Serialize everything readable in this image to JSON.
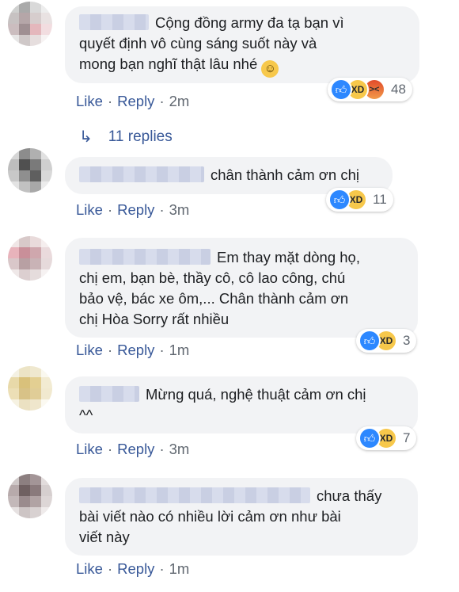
{
  "comments": [
    {
      "text_lines": [
        "Cộng đồng army đa tạ bạn vì",
        "quyết định vô cùng sáng suốt này và",
        "mong bạn nghĩ thật lâu nhé"
      ],
      "emoji": "☺",
      "actions": {
        "like": "Like",
        "reply": "Reply",
        "time": "2m"
      },
      "reaction_count": "48",
      "avatar_colors": [
        "#cfd0cf",
        "#a9a9a9",
        "#d9d9d9",
        "#ededed",
        "#c7c2c2",
        "#b5a6a8",
        "#d6cdcd",
        "#e9e2e2",
        "#cbbdbf",
        "#9f8f92",
        "#e4b7bc",
        "#f2dde0",
        "#e7e6e6",
        "#cfc8c8",
        "#e6dede",
        "#f7f3f3"
      ]
    },
    {
      "text_lines": [
        "chân thành cảm ơn chị"
      ],
      "actions": {
        "like": "Like",
        "reply": "Reply",
        "time": "3m"
      },
      "reaction_count": "11",
      "avatar_colors": [
        "#d6d6d6",
        "#8c8c8c",
        "#b0b0b0",
        "#e1e1e1",
        "#bdbdbd",
        "#505050",
        "#7a7a7a",
        "#cfcfcf",
        "#c8c8c8",
        "#8f8f8f",
        "#5f5f5f",
        "#d9d9d9",
        "#e3e3e3",
        "#c1c1c1",
        "#a8a8a8",
        "#ececec"
      ]
    },
    {
      "text_lines": [
        "Em thay mặt dòng họ,",
        "chị em, bạn bè, thầy cô, cô lao công, chú",
        "bảo vệ, bác xe ôm,... Chân thành cảm ơn",
        "chị Hòa Sorry rất nhiều"
      ],
      "actions": {
        "like": "Like",
        "reply": "Reply",
        "time": "1m"
      },
      "reaction_count": "3",
      "avatar_colors": [
        "#f0e6e6",
        "#d8c9c9",
        "#e9dbdb",
        "#f5eeee",
        "#e8b3bb",
        "#c98f99",
        "#cfa7ad",
        "#eadadc",
        "#d9c7c9",
        "#b8a0a3",
        "#c9b3b6",
        "#e6dadb",
        "#efe8e8",
        "#dccfd0",
        "#e5dcdc",
        "#f6f2f2"
      ]
    },
    {
      "text_lines": [
        "Mừng quá, nghệ thuật cảm ơn chị",
        "^^"
      ],
      "actions": {
        "like": "Like",
        "reply": "Reply",
        "time": "3m"
      },
      "reaction_count": "7",
      "avatar_colors": [
        "#f4f1e3",
        "#ece4c6",
        "#efe8cf",
        "#faf8ef",
        "#e8d9a9",
        "#d9c17b",
        "#e3cf92",
        "#f2ebd2",
        "#ecdfb6",
        "#d8c287",
        "#e0cd97",
        "#f1e9cf",
        "#f6f2e2",
        "#ebe1c2",
        "#efe6cc",
        "#fbf9f1"
      ]
    },
    {
      "text_lines": [
        "chưa thấy",
        "bài viết nào có nhiều lời cảm ơn như bài",
        "viết này"
      ],
      "actions": {
        "like": "Like",
        "reply": "Reply",
        "time": "1m"
      },
      "avatar_colors": [
        "#cfc8c8",
        "#8c7f80",
        "#a39597",
        "#e2dcdc",
        "#b7aaab",
        "#6f6061",
        "#8a7a7c",
        "#d6cfcf",
        "#c3b8b9",
        "#9a8b8d",
        "#b1a3a4",
        "#ddd6d6",
        "#e6e1e1",
        "#cdc5c5",
        "#d8d1d1",
        "#efebeb"
      ]
    }
  ],
  "replies_link": "11 replies",
  "icons": {
    "like": "thumbs-up-icon",
    "haha": "haha-icon",
    "angry": "angry-icon",
    "reply_arrow": "reply-arrow-icon"
  }
}
